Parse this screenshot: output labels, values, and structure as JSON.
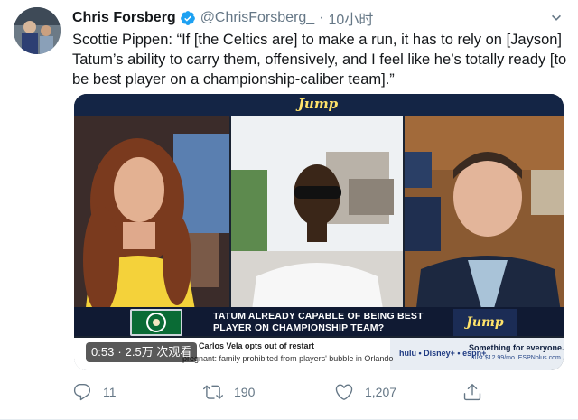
{
  "tweet": {
    "author_name": "Chris Forsberg",
    "handle": "@ChrisForsberg_",
    "separator": "·",
    "time": "10小时",
    "text": "Scottie Pippen: “If [the Celtics are] to make a run, it has to rely on [Jayson] Tatum’s ability to carry them, offensively, and I feel like he’s totally ready [to be best player on a championship-caliber team].”",
    "colors": {
      "verified": "#1da1f2",
      "secondary_text": "#657786",
      "primary_text": "#14171a"
    }
  },
  "video": {
    "show_logo": "Jump",
    "banner_text": "TATUM ALREADY CAPABLE OF BEING BEST PLAYER ON CHAMPIONSHIP TEAM?",
    "banner_logo": "Jump",
    "ticker_line1": "Carlos Vela opts out of restart",
    "ticker_line2": "pregnant: family prohibited from players' bubble in Orlando",
    "ad_brand": "hulu • Disney+ • espn+",
    "ad_line1": "Something for everyone.",
    "ad_line2": "Just $12.99/mo. ESPNplus.com",
    "timestamp": "0:53",
    "views": "2.5万 次观看",
    "overlay_separator": "·"
  },
  "actions": {
    "reply_count": "11",
    "retweet_count": "190",
    "like_count": "1,207",
    "icons": [
      "reply-icon",
      "retweet-icon",
      "like-icon",
      "share-icon"
    ]
  }
}
